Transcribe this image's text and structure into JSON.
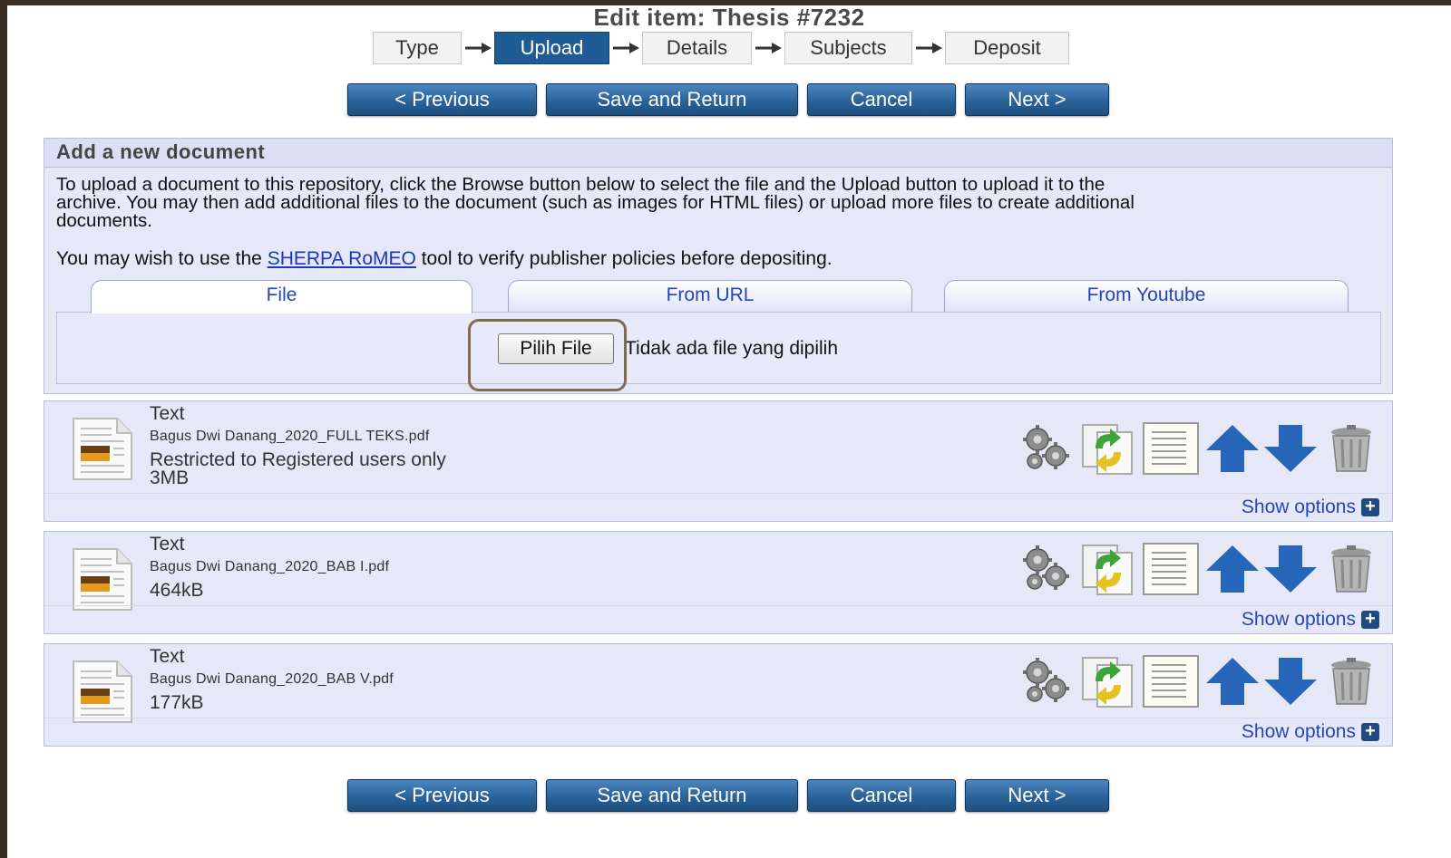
{
  "page": {
    "title": "Edit item: Thesis #7232"
  },
  "stages": [
    {
      "label": "Type",
      "active": false
    },
    {
      "label": "Upload",
      "active": true
    },
    {
      "label": "Details",
      "active": false
    },
    {
      "label": "Subjects",
      "active": false
    },
    {
      "label": "Deposit",
      "active": false
    }
  ],
  "buttons": {
    "previous": "< Previous",
    "save_return": "Save and Return",
    "cancel": "Cancel",
    "next": "Next >"
  },
  "upload": {
    "heading": "Add a new document",
    "intro_line1": "To upload a document to this repository, click the Browse button below to select the file and the Upload button to upload it to the",
    "intro_line2": "archive. You may then add additional files to the document (such as images for HTML files) or upload more files to create additional",
    "intro_line3": "documents.",
    "sherpa_before": "You may wish to use the ",
    "sherpa_link": "SHERPA RoMEO",
    "sherpa_after": " tool to verify publisher policies before depositing.",
    "tabs": [
      {
        "label": "File",
        "active": true
      },
      {
        "label": "From URL",
        "active": false
      },
      {
        "label": "From Youtube",
        "active": false
      }
    ],
    "file_button": "Pilih File",
    "file_status": "Tidak ada file yang dipilih"
  },
  "documents": [
    {
      "type": "Text",
      "filename": "Bagus Dwi Danang_2020_FULL TEKS.pdf",
      "restriction": "Restricted to Registered users only",
      "size": "3MB",
      "show_options": "Show options"
    },
    {
      "type": "Text",
      "filename": "Bagus Dwi Danang_2020_BAB I.pdf",
      "size": "464kB",
      "show_options": "Show options"
    },
    {
      "type": "Text",
      "filename": "Bagus Dwi Danang_2020_BAB V.pdf",
      "size": "177kB",
      "show_options": "Show options"
    }
  ],
  "doc_actions": [
    "gears-icon",
    "convert-icon",
    "document-list-icon",
    "arrow-up-icon",
    "arrow-down-icon",
    "trash-icon"
  ],
  "colors": {
    "button_blue": "#2a6399",
    "active_stage": "#1f5c94",
    "panel_bg": "#e6e8f8",
    "link": "#1a38c0",
    "highlight_border": "#7d6d4c"
  }
}
